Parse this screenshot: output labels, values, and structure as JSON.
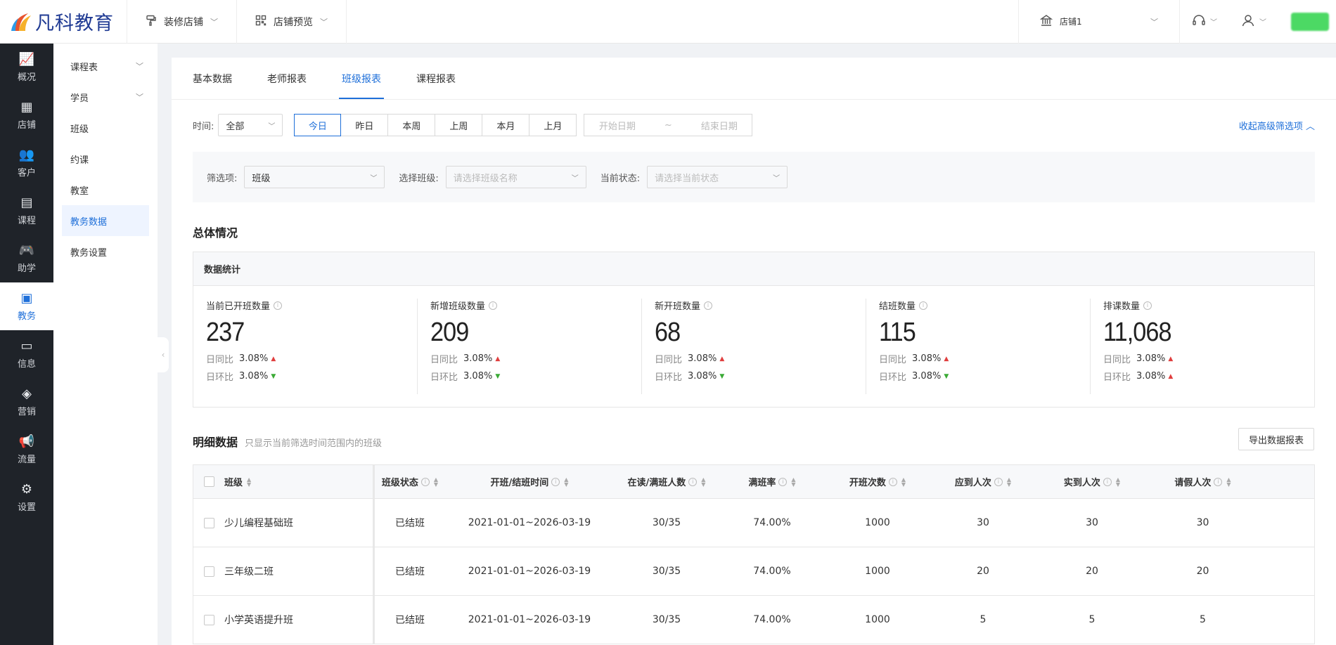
{
  "brand": {
    "name": "凡科教育"
  },
  "topnav": [
    {
      "label": "装修店铺",
      "icon": "paint-roller-icon"
    },
    {
      "label": "店铺预览",
      "icon": "qrcode-icon"
    }
  ],
  "store": {
    "label": "店铺1",
    "icon": "bank-icon"
  },
  "sidebar_primary": [
    {
      "label": "概况",
      "icon": "chart-icon"
    },
    {
      "label": "店铺",
      "icon": "shop-icon"
    },
    {
      "label": "客户",
      "icon": "users-icon"
    },
    {
      "label": "课程",
      "icon": "document-icon"
    },
    {
      "label": "助学",
      "icon": "gamepad-icon"
    },
    {
      "label": "教务",
      "icon": "book-icon",
      "active": true
    },
    {
      "label": "信息",
      "icon": "message-icon"
    },
    {
      "label": "营销",
      "icon": "tag-icon"
    },
    {
      "label": "流量",
      "icon": "megaphone-icon"
    },
    {
      "label": "设置",
      "icon": "gear-icon"
    }
  ],
  "sidebar_secondary": [
    {
      "label": "课程表",
      "expandable": true
    },
    {
      "label": "学员",
      "expandable": true
    },
    {
      "label": "班级"
    },
    {
      "label": "约课"
    },
    {
      "label": "教室"
    },
    {
      "label": "教务数据",
      "active": true
    },
    {
      "label": "教务设置"
    }
  ],
  "tabs": [
    "基本数据",
    "老师报表",
    "班级报表",
    "课程报表"
  ],
  "filters": {
    "time_label": "时间:",
    "time_select": "全部",
    "quick": [
      "今日",
      "昨日",
      "本周",
      "上周",
      "本月",
      "上月"
    ],
    "start_placeholder": "开始日期",
    "range_sep": "~",
    "end_placeholder": "结束日期",
    "collapse_label": "收起高级筛选项",
    "filter_label": "筛选项:",
    "filter_value": "班级",
    "class_label": "选择班级:",
    "class_placeholder": "请选择班级名称",
    "state_label": "当前状态:",
    "state_placeholder": "请选择当前状态"
  },
  "overview": {
    "title": "总体情况",
    "box_title": "数据统计",
    "day_label": "日同比",
    "ring_label": "日环比",
    "stats": [
      {
        "label": "当前已开班数量",
        "value": "237",
        "day": "3.08%",
        "day_dir": "up",
        "ring": "3.08%",
        "ring_dir": "down"
      },
      {
        "label": "新增班级数量",
        "value": "209",
        "day": "3.08%",
        "day_dir": "up",
        "ring": "3.08%",
        "ring_dir": "down"
      },
      {
        "label": "新开班数量",
        "value": "68",
        "day": "3.08%",
        "day_dir": "up",
        "ring": "3.08%",
        "ring_dir": "down"
      },
      {
        "label": "结班数量",
        "value": "115",
        "day": "3.08%",
        "day_dir": "up",
        "ring": "3.08%",
        "ring_dir": "down"
      },
      {
        "label": "排课数量",
        "value": "11,068",
        "day": "3.08%",
        "day_dir": "up",
        "ring": "3.08%",
        "ring_dir": "up"
      }
    ]
  },
  "detail": {
    "title": "明细数据",
    "subtitle": "只显示当前筛选时间范围内的班级",
    "export_label": "导出数据报表",
    "columns": [
      "班级",
      "班级状态",
      "开班/结班时间",
      "在读/满班人数",
      "满班率",
      "开班次数",
      "应到人次",
      "实到人次",
      "请假人次"
    ],
    "rows": [
      [
        "少儿编程基础班",
        "已结班",
        "2021-01-01~2026-03-19",
        "30/35",
        "74.00%",
        "1000",
        "30",
        "30",
        "30"
      ],
      [
        "三年级二班",
        "已结班",
        "2021-01-01~2026-03-19",
        "30/35",
        "74.00%",
        "1000",
        "20",
        "20",
        "20"
      ],
      [
        "小学英语提升班",
        "已结班",
        "2021-01-01~2026-03-19",
        "30/35",
        "74.00%",
        "1000",
        "5",
        "5",
        "5"
      ]
    ]
  },
  "colors": {
    "accent": "#1e6fd9",
    "sidebar_bg": "#1f2329",
    "up": "#e03e3e",
    "down": "#3aaa35"
  }
}
